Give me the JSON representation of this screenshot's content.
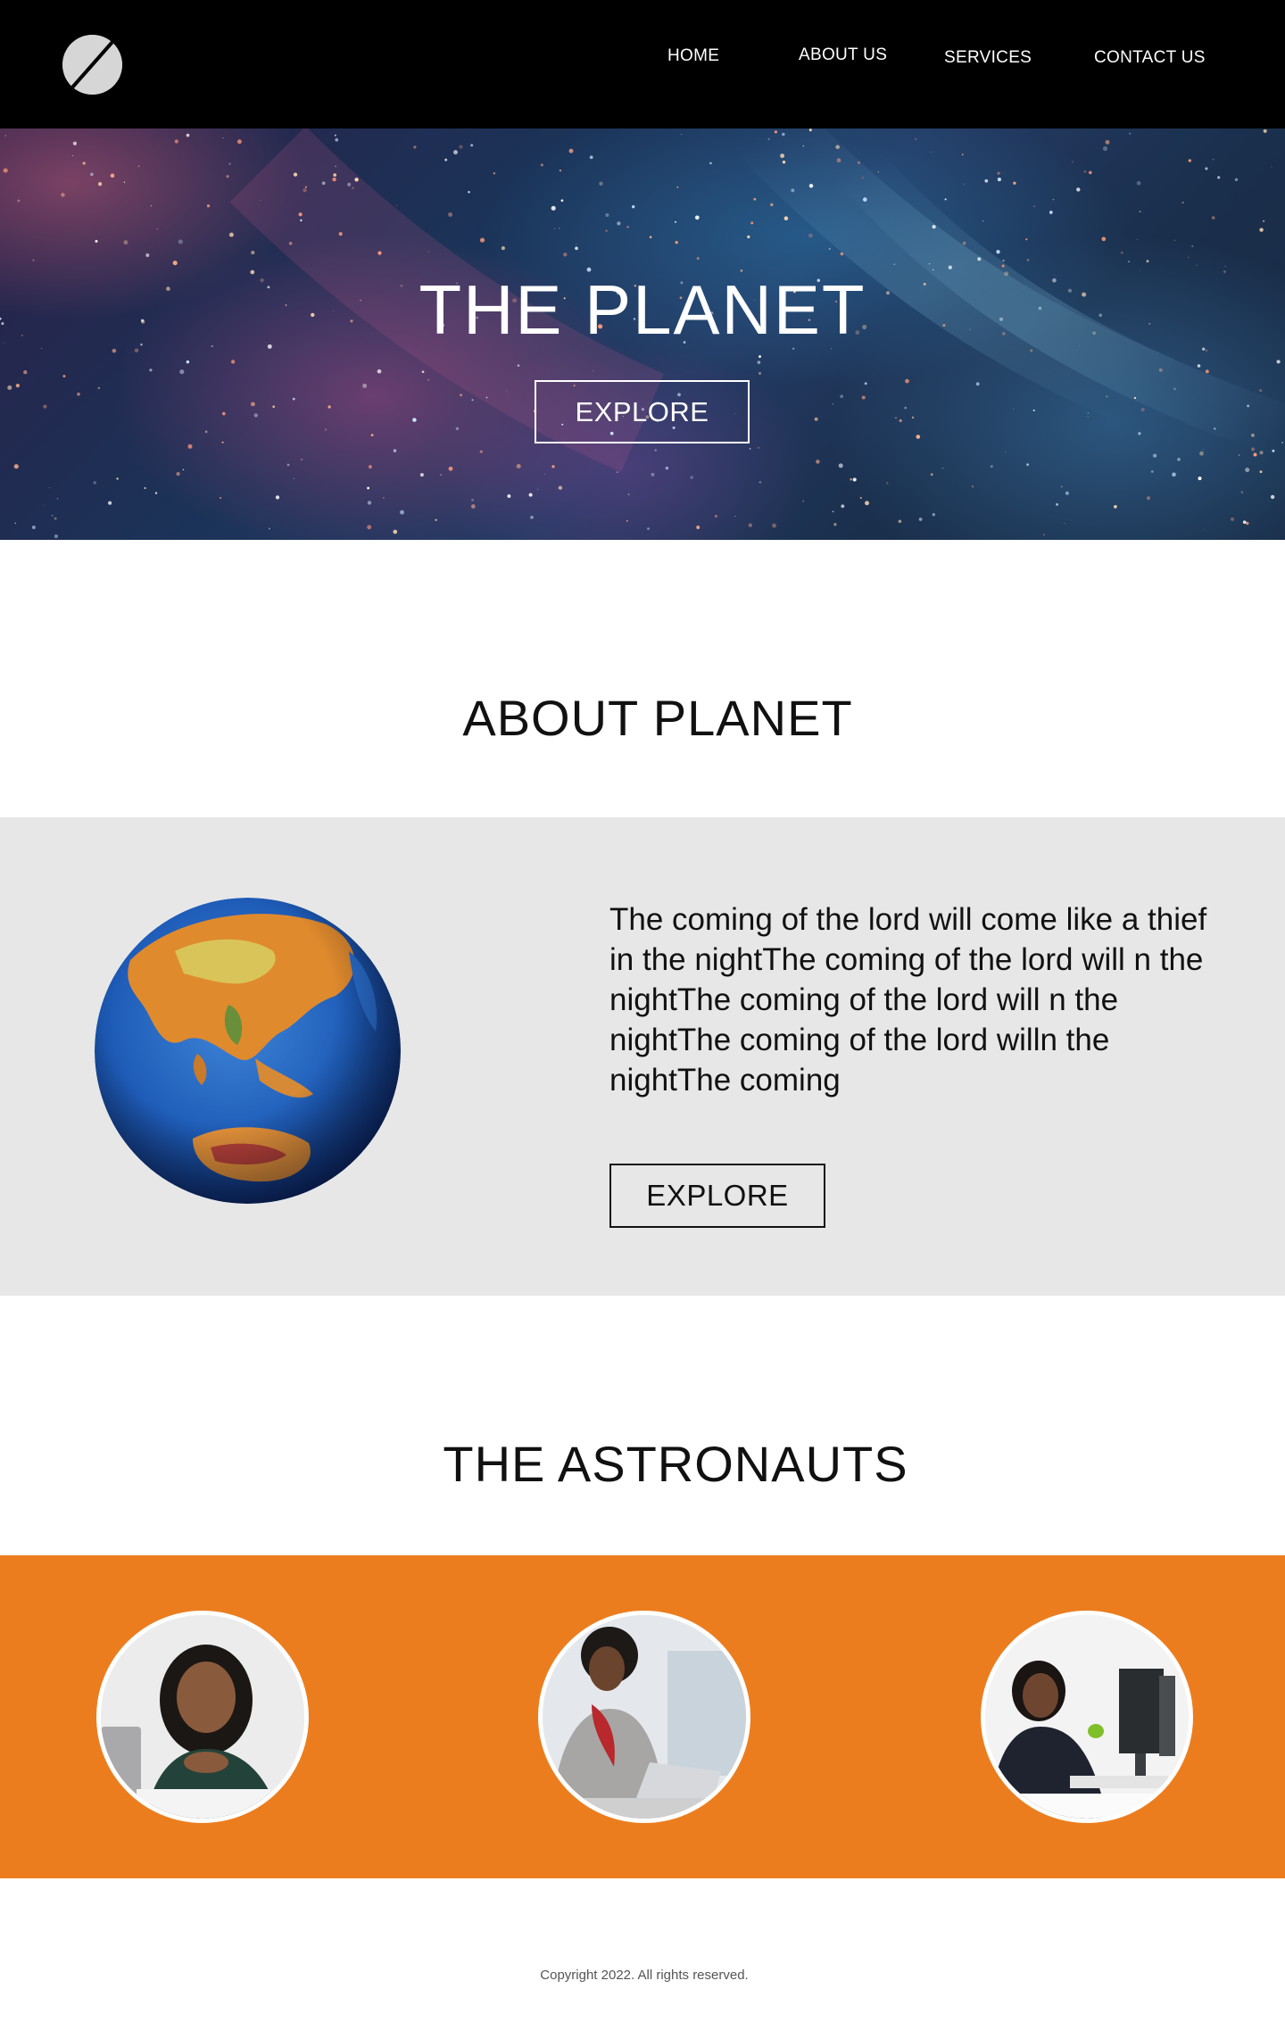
{
  "header": {
    "logo_icon": "slashed-circle-logo",
    "nav": [
      "HOME",
      "ABOUT US",
      "SERVICES",
      "CONTACT US"
    ]
  },
  "hero": {
    "title": "THE PLANET",
    "button_label": "EXPLORE"
  },
  "about": {
    "title": "ABOUT PLANET",
    "text": "The coming of the lord will come like a thief in the nightThe coming of the lord will n the nightThe coming of the lord will n the nightThe coming of the lord willn the nightThe coming",
    "button_label": "EXPLORE",
    "image": "earth-globe-image"
  },
  "astronauts": {
    "title": "THE ASTRONAUTS",
    "people": [
      {
        "image": "woman-smiling-at-laptop-photo"
      },
      {
        "image": "woman-with-red-scarf-at-laptop-photo"
      },
      {
        "image": "woman-at-desktop-computer-photo"
      }
    ]
  },
  "footer": {
    "copyright": "Copyright 2022. All rights reserved."
  },
  "colors": {
    "header_bg": "#000000",
    "about_band_bg": "#e7e7e8",
    "astronauts_band_bg": "#ec7d1e",
    "text_dark": "#111111"
  }
}
